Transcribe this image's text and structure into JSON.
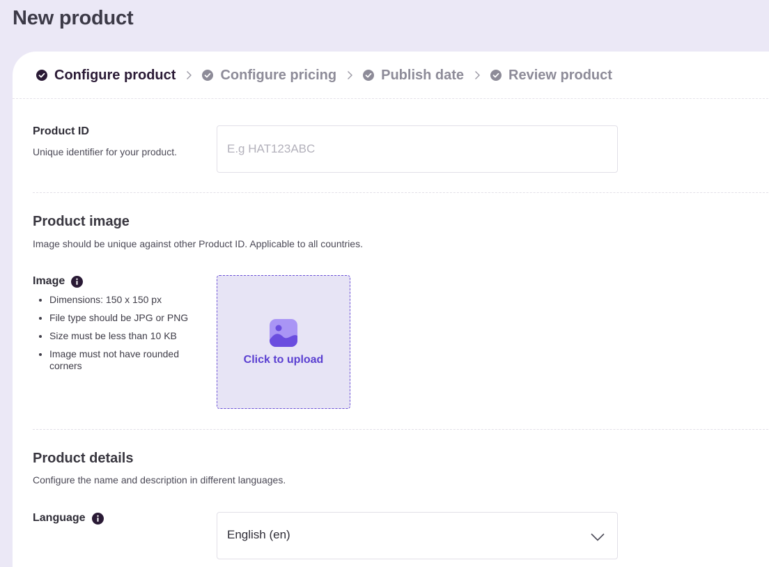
{
  "page": {
    "title": "New product"
  },
  "stepper": {
    "steps": [
      {
        "label": "Configure product",
        "active": true
      },
      {
        "label": "Configure pricing",
        "active": false
      },
      {
        "label": "Publish date",
        "active": false
      },
      {
        "label": "Review product",
        "active": false
      }
    ]
  },
  "product_id": {
    "label": "Product ID",
    "description": "Unique identifier for your product.",
    "placeholder": "E.g HAT123ABC",
    "value": ""
  },
  "product_image": {
    "title": "Product image",
    "description": "Image should be unique against other Product ID. Applicable to all countries.",
    "image_label": "Image",
    "requirements": [
      "Dimensions: 150 x 150 px",
      "File type should be JPG or PNG",
      "Size must be less than 10 KB",
      "Image must not have rounded corners"
    ],
    "upload_label": "Click to upload",
    "upload_icon": "image-upload-icon"
  },
  "product_details": {
    "title": "Product details",
    "description": "Configure the name and description in different languages.",
    "language_label": "Language",
    "language_value": "English (en)"
  },
  "colors": {
    "background": "#ebe8f6",
    "accent": "#5a3fd1",
    "active_step": "#2a1a35",
    "inactive_step": "#8d8b98",
    "upload_bg": "#e7e4f5"
  }
}
